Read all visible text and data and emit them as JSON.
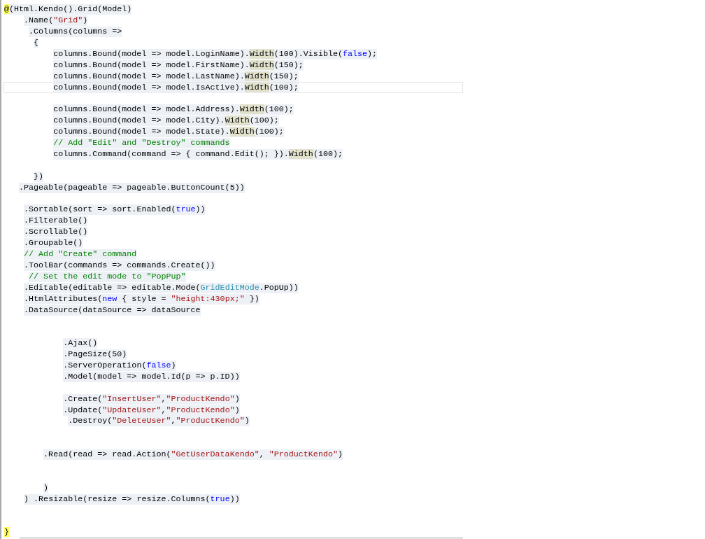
{
  "editor": {
    "lines": [
      {
        "kind": "code",
        "current": false,
        "tokens": [
          {
            "kind": "match",
            "text": "@"
          },
          {
            "kind": "plain",
            "text": "(Html.Kendo().Grid(Model)"
          }
        ]
      },
      {
        "kind": "code",
        "current": false,
        "tokens": [
          {
            "kind": "plain",
            "text": "    .Name("
          },
          {
            "kind": "string",
            "text": "\"Grid\""
          },
          {
            "kind": "plain",
            "text": ")"
          }
        ]
      },
      {
        "kind": "code",
        "current": false,
        "tokens": [
          {
            "kind": "plain",
            "text": "     .Columns(columns =>"
          }
        ]
      },
      {
        "kind": "code",
        "current": false,
        "tokens": [
          {
            "kind": "plain",
            "text": "      {"
          }
        ]
      },
      {
        "kind": "code",
        "current": false,
        "tokens": [
          {
            "kind": "plain",
            "text": "          columns.Bound(model => model.LoginName)."
          },
          {
            "kind": "ref",
            "text": "Width"
          },
          {
            "kind": "plain",
            "text": "(100).Visible("
          },
          {
            "kind": "keyword",
            "text": "false"
          },
          {
            "kind": "plain",
            "text": ");"
          }
        ]
      },
      {
        "kind": "code",
        "current": false,
        "tokens": [
          {
            "kind": "plain",
            "text": "          columns.Bound(model => model.FirstName)."
          },
          {
            "kind": "ref",
            "text": "Width"
          },
          {
            "kind": "plain",
            "text": "(150);"
          }
        ]
      },
      {
        "kind": "code",
        "current": false,
        "tokens": [
          {
            "kind": "plain",
            "text": "          columns.Bound(model => model.LastName)."
          },
          {
            "kind": "ref",
            "text": "Width"
          },
          {
            "kind": "plain",
            "text": "(150);"
          }
        ]
      },
      {
        "kind": "code",
        "current": true,
        "tokens": [
          {
            "kind": "plain",
            "text": "          columns.Bound(model => model.IsActive)."
          },
          {
            "kind": "ref",
            "text": "Width"
          },
          {
            "kind": "plain",
            "text": "(100);"
          }
        ]
      },
      {
        "kind": "blank",
        "current": false
      },
      {
        "kind": "code",
        "current": false,
        "tokens": [
          {
            "kind": "plain",
            "text": "          columns.Bound(model => model.Address)."
          },
          {
            "kind": "ref",
            "text": "Width"
          },
          {
            "kind": "plain",
            "text": "(100);"
          }
        ]
      },
      {
        "kind": "code",
        "current": false,
        "tokens": [
          {
            "kind": "plain",
            "text": "          columns.Bound(model => model.City)."
          },
          {
            "kind": "ref",
            "text": "Width"
          },
          {
            "kind": "plain",
            "text": "(100);"
          }
        ]
      },
      {
        "kind": "code",
        "current": false,
        "tokens": [
          {
            "kind": "plain",
            "text": "          columns.Bound(model => model.State)."
          },
          {
            "kind": "ref",
            "text": "Width"
          },
          {
            "kind": "plain",
            "text": "(100);"
          }
        ]
      },
      {
        "kind": "code",
        "current": false,
        "tokens": [
          {
            "kind": "comment",
            "text": "          // Add \"Edit\" and \"Destroy\" commands"
          }
        ]
      },
      {
        "kind": "code",
        "current": false,
        "tokens": [
          {
            "kind": "plain",
            "text": "          columns.Command(command => { command.Edit(); })."
          },
          {
            "kind": "ref",
            "text": "Width"
          },
          {
            "kind": "plain",
            "text": "(100);"
          }
        ]
      },
      {
        "kind": "blank",
        "current": false
      },
      {
        "kind": "code",
        "current": false,
        "tokens": [
          {
            "kind": "plain",
            "text": "      })"
          }
        ]
      },
      {
        "kind": "code",
        "current": false,
        "tokens": [
          {
            "kind": "plain",
            "text": "   .Pageable(pageable => pageable.ButtonCount(5))"
          }
        ]
      },
      {
        "kind": "blank",
        "current": false
      },
      {
        "kind": "code",
        "current": false,
        "tokens": [
          {
            "kind": "plain",
            "text": "    .Sortable(sort => sort.Enabled("
          },
          {
            "kind": "keyword",
            "text": "true"
          },
          {
            "kind": "plain",
            "text": "))"
          }
        ]
      },
      {
        "kind": "code",
        "current": false,
        "tokens": [
          {
            "kind": "plain",
            "text": "    .Filterable()"
          }
        ]
      },
      {
        "kind": "code",
        "current": false,
        "tokens": [
          {
            "kind": "plain",
            "text": "    .Scrollable()"
          }
        ]
      },
      {
        "kind": "code",
        "current": false,
        "tokens": [
          {
            "kind": "plain",
            "text": "    .Groupable()"
          }
        ]
      },
      {
        "kind": "code",
        "current": false,
        "tokens": [
          {
            "kind": "comment",
            "text": "    // Add \"Create\" command"
          }
        ]
      },
      {
        "kind": "code",
        "current": false,
        "tokens": [
          {
            "kind": "plain",
            "text": "    .ToolBar(commands => commands.Create())"
          }
        ]
      },
      {
        "kind": "code",
        "current": false,
        "tokens": [
          {
            "kind": "comment",
            "text": "     // Set the edit mode to \"PopPup\""
          }
        ]
      },
      {
        "kind": "code",
        "current": false,
        "tokens": [
          {
            "kind": "plain",
            "text": "    .Editable(editable => editable.Mode("
          },
          {
            "kind": "type",
            "text": "GridEditMode"
          },
          {
            "kind": "plain",
            "text": ".PopUp))"
          }
        ]
      },
      {
        "kind": "code",
        "current": false,
        "tokens": [
          {
            "kind": "plain",
            "text": "    .HtmlAttributes("
          },
          {
            "kind": "keyword",
            "text": "new"
          },
          {
            "kind": "plain",
            "text": " { style = "
          },
          {
            "kind": "string",
            "text": "\"height:430px;\""
          },
          {
            "kind": "plain",
            "text": " })"
          }
        ]
      },
      {
        "kind": "code",
        "current": false,
        "tokens": [
          {
            "kind": "plain",
            "text": "    .DataSource(dataSource => dataSource"
          }
        ]
      },
      {
        "kind": "blank",
        "current": false
      },
      {
        "kind": "blank",
        "current": false
      },
      {
        "kind": "code",
        "current": false,
        "tokens": [
          {
            "kind": "plain",
            "text": "            .Ajax()"
          }
        ]
      },
      {
        "kind": "code",
        "current": false,
        "tokens": [
          {
            "kind": "plain",
            "text": "            .PageSize(50)"
          }
        ]
      },
      {
        "kind": "code",
        "current": false,
        "tokens": [
          {
            "kind": "plain",
            "text": "            .ServerOperation("
          },
          {
            "kind": "keyword",
            "text": "false"
          },
          {
            "kind": "plain",
            "text": ")"
          }
        ]
      },
      {
        "kind": "code",
        "current": false,
        "tokens": [
          {
            "kind": "plain",
            "text": "            .Model(model => model.Id(p => p.ID))"
          }
        ]
      },
      {
        "kind": "blank",
        "current": false
      },
      {
        "kind": "code",
        "current": false,
        "tokens": [
          {
            "kind": "plain",
            "text": "            .Create("
          },
          {
            "kind": "string",
            "text": "\"InsertUser\""
          },
          {
            "kind": "plain",
            "text": ","
          },
          {
            "kind": "string",
            "text": "\"ProductKendo\""
          },
          {
            "kind": "plain",
            "text": ")"
          }
        ]
      },
      {
        "kind": "code",
        "current": false,
        "tokens": [
          {
            "kind": "plain",
            "text": "            .Update("
          },
          {
            "kind": "string",
            "text": "\"UpdateUser\""
          },
          {
            "kind": "plain",
            "text": ","
          },
          {
            "kind": "string",
            "text": "\"ProductKendo\""
          },
          {
            "kind": "plain",
            "text": ")"
          }
        ]
      },
      {
        "kind": "code",
        "current": false,
        "tokens": [
          {
            "kind": "plain",
            "text": "             .Destroy("
          },
          {
            "kind": "string",
            "text": "\"DeleteUser\""
          },
          {
            "kind": "plain",
            "text": ","
          },
          {
            "kind": "string",
            "text": "\"ProductKendo\""
          },
          {
            "kind": "plain",
            "text": ")"
          }
        ]
      },
      {
        "kind": "blank",
        "current": false
      },
      {
        "kind": "blank",
        "current": false
      },
      {
        "kind": "code",
        "current": false,
        "tokens": [
          {
            "kind": "plain",
            "text": "        .Read(read => read.Action("
          },
          {
            "kind": "string",
            "text": "\"GetUserDataKendo\""
          },
          {
            "kind": "plain",
            "text": ", "
          },
          {
            "kind": "string",
            "text": "\"ProductKendo\""
          },
          {
            "kind": "plain",
            "text": ")"
          }
        ]
      },
      {
        "kind": "blank",
        "current": false
      },
      {
        "kind": "blank",
        "current": false
      },
      {
        "kind": "code",
        "current": false,
        "tokens": [
          {
            "kind": "plain",
            "text": "        )"
          }
        ]
      },
      {
        "kind": "code",
        "current": false,
        "tokens": [
          {
            "kind": "plain",
            "text": "    ) .Resizable(resize => resize.Columns("
          },
          {
            "kind": "keyword",
            "text": "true"
          },
          {
            "kind": "plain",
            "text": "))"
          }
        ]
      },
      {
        "kind": "blank",
        "current": false
      },
      {
        "kind": "blank",
        "current": false
      },
      {
        "kind": "code",
        "current": false,
        "tokens": [
          {
            "kind": "match",
            "text": "}"
          }
        ]
      }
    ]
  }
}
